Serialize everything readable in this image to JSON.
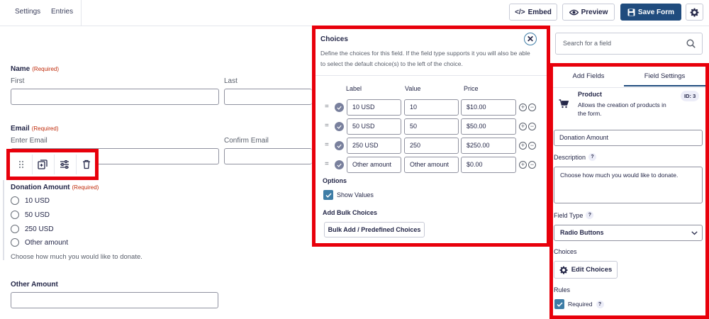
{
  "topbar": {
    "tabs": [
      "Settings",
      "Entries"
    ],
    "embed_label": "Embed",
    "preview_label": "Preview",
    "save_label": "Save Form"
  },
  "form": {
    "name": {
      "label": "Name",
      "required": "(Required)",
      "first": "First",
      "last": "Last"
    },
    "email": {
      "label": "Email",
      "required": "(Required)",
      "enter": "Enter Email",
      "confirm": "Confirm Email"
    },
    "donation": {
      "label": "Donation Amount",
      "required": "(Required)",
      "options": [
        "10 USD",
        "50 USD",
        "250 USD",
        "Other amount"
      ],
      "description": "Choose how much you would like to donate."
    },
    "other": {
      "label": "Other Amount"
    }
  },
  "choices_panel": {
    "title": "Choices",
    "description": "Define the choices for this field. If the field type supports it you will also be able to select the default choice(s) to the left of the choice.",
    "columns": [
      "Label",
      "Value",
      "Price"
    ],
    "rows": [
      {
        "label": "10 USD",
        "value": "10",
        "price": "$10.00"
      },
      {
        "label": "50 USD",
        "value": "50",
        "price": "$50.00"
      },
      {
        "label": "250 USD",
        "value": "250",
        "price": "$250.00"
      },
      {
        "label": "Other amount",
        "value": "Other amount",
        "price": "$0.00"
      }
    ],
    "options_label": "Options",
    "show_values": "Show Values",
    "bulk_label": "Add Bulk Choices",
    "bulk_button": "Bulk Add / Predefined Choices"
  },
  "sidebar": {
    "search_placeholder": "Search for a field",
    "tabs": [
      "Add Fields",
      "Field Settings"
    ],
    "field_title": "Product",
    "field_id": "ID: 3",
    "field_desc": "Allows the creation of products in the form.",
    "field_label_value": "Donation Amount",
    "description_label": "Description",
    "description_value": "Choose how much you would like to donate.",
    "field_type_label": "Field Type",
    "field_type_value": "Radio Buttons",
    "choices_label": "Choices",
    "edit_choices": "Edit Choices",
    "rules_label": "Rules",
    "required_label": "Required",
    "help": "?"
  },
  "colors": {
    "accent": "#204c7e",
    "highlight": "#e8000b",
    "checkbox": "#3e7da6"
  }
}
